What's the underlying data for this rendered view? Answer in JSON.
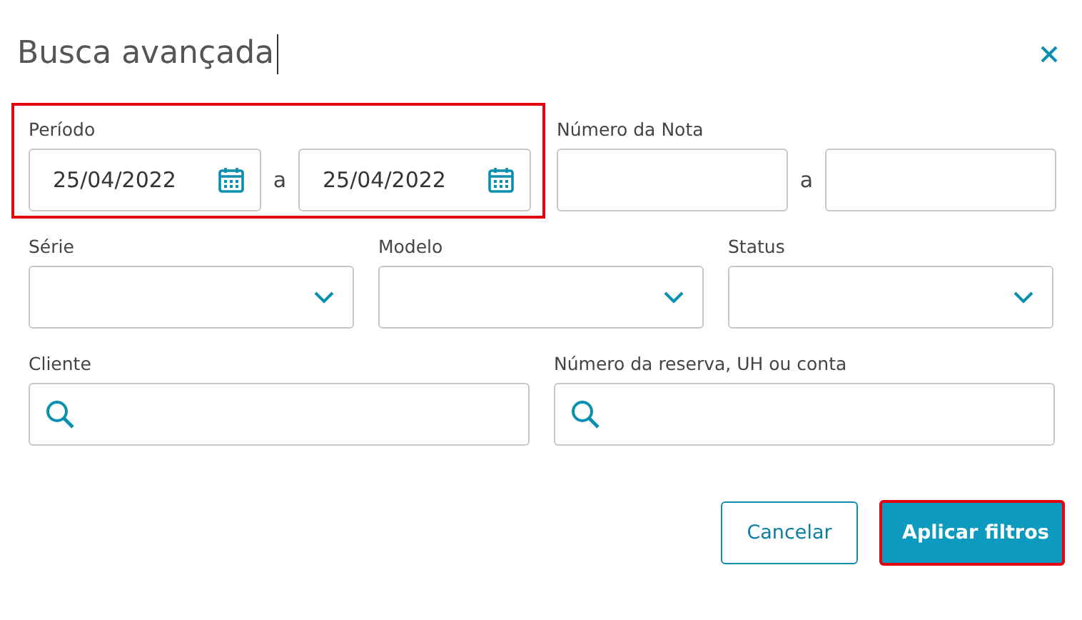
{
  "dialog": {
    "title": "Busca avançada"
  },
  "period": {
    "label": "Período",
    "from": "25/04/2022",
    "separator": "a",
    "to": "25/04/2022",
    "highlighted": true
  },
  "invoice_number": {
    "label": "Número da Nota",
    "separator": "a"
  },
  "selects": [
    {
      "label": "Série"
    },
    {
      "label": "Modelo"
    },
    {
      "label": "Status"
    }
  ],
  "searches": [
    {
      "label": "Cliente"
    },
    {
      "label": "Número da reserva, UH ou conta"
    }
  ],
  "buttons": [
    {
      "label": "Cancelar",
      "kind": "secondary",
      "highlighted": false
    },
    {
      "label": "Aplicar filtros",
      "kind": "primary",
      "highlighted": true
    }
  ]
}
